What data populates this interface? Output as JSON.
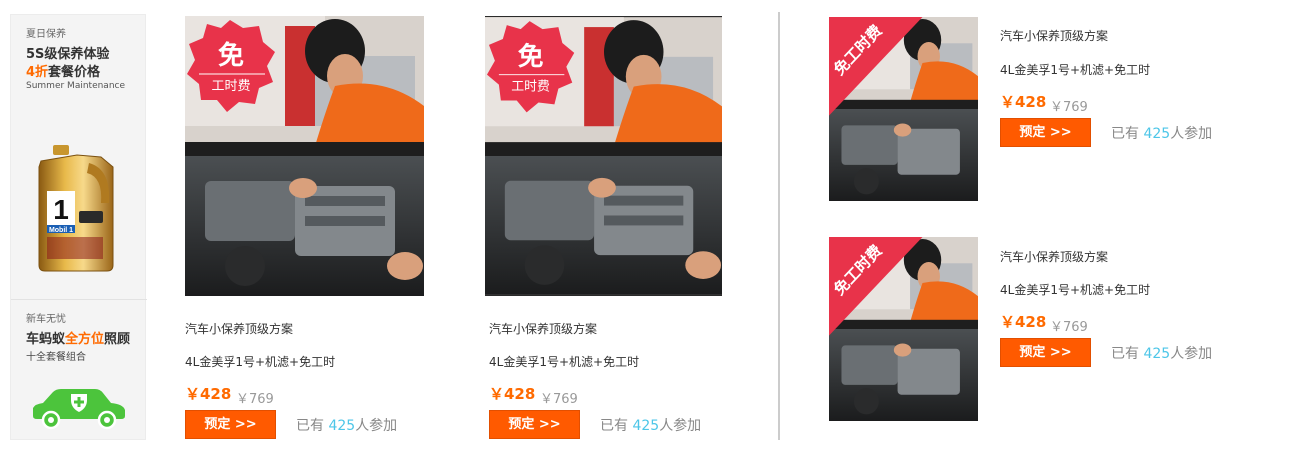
{
  "sidebar": {
    "promo1": {
      "small": "夏日保养",
      "line1": "5S级保养体验",
      "line2_hl": "4折",
      "line2_rest": "套餐价格",
      "en": "Summer Maintenance",
      "oil_brand": "Mobil 1"
    },
    "promo2": {
      "small": "新车无忧",
      "line1_a": "车蚂蚁",
      "line1_hl": "全方位",
      "line1_b": "照顾",
      "sub": "十全套餐组合"
    }
  },
  "badge": {
    "top": "免",
    "bottom": "工时费",
    "ribbon": "免工时费"
  },
  "products": [
    {
      "title": "汽车小保养顶级方案",
      "desc": "4L金美孚1号+机滤+免工时",
      "price": "￥428",
      "old_price": "￥769",
      "button": "预定 >>",
      "joined_prefix": "已有 ",
      "joined_count": "425",
      "joined_suffix": "人参加"
    },
    {
      "title": "汽车小保养顶级方案",
      "desc": "4L金美孚1号+机滤+免工时",
      "price": "￥428",
      "old_price": "￥769",
      "button": "预定 >>",
      "joined_prefix": "已有 ",
      "joined_count": "425",
      "joined_suffix": "人参加"
    },
    {
      "title": "汽车小保养顶级方案",
      "desc": "4L金美孚1号+机滤+免工时",
      "price": "￥428",
      "old_price": "￥769",
      "button": "预定 >>",
      "joined_prefix": "已有 ",
      "joined_count": "425",
      "joined_suffix": "人参加"
    },
    {
      "title": "汽车小保养顶级方案",
      "desc": "4L金美孚1号+机滤+免工时",
      "price": "￥428",
      "old_price": "￥769",
      "button": "预定 >>",
      "joined_prefix": "已有 ",
      "joined_count": "425",
      "joined_suffix": "人参加"
    }
  ],
  "colors": {
    "accent": "#ff5a00",
    "count": "#4dc6e8",
    "badge": "#e8334a"
  }
}
